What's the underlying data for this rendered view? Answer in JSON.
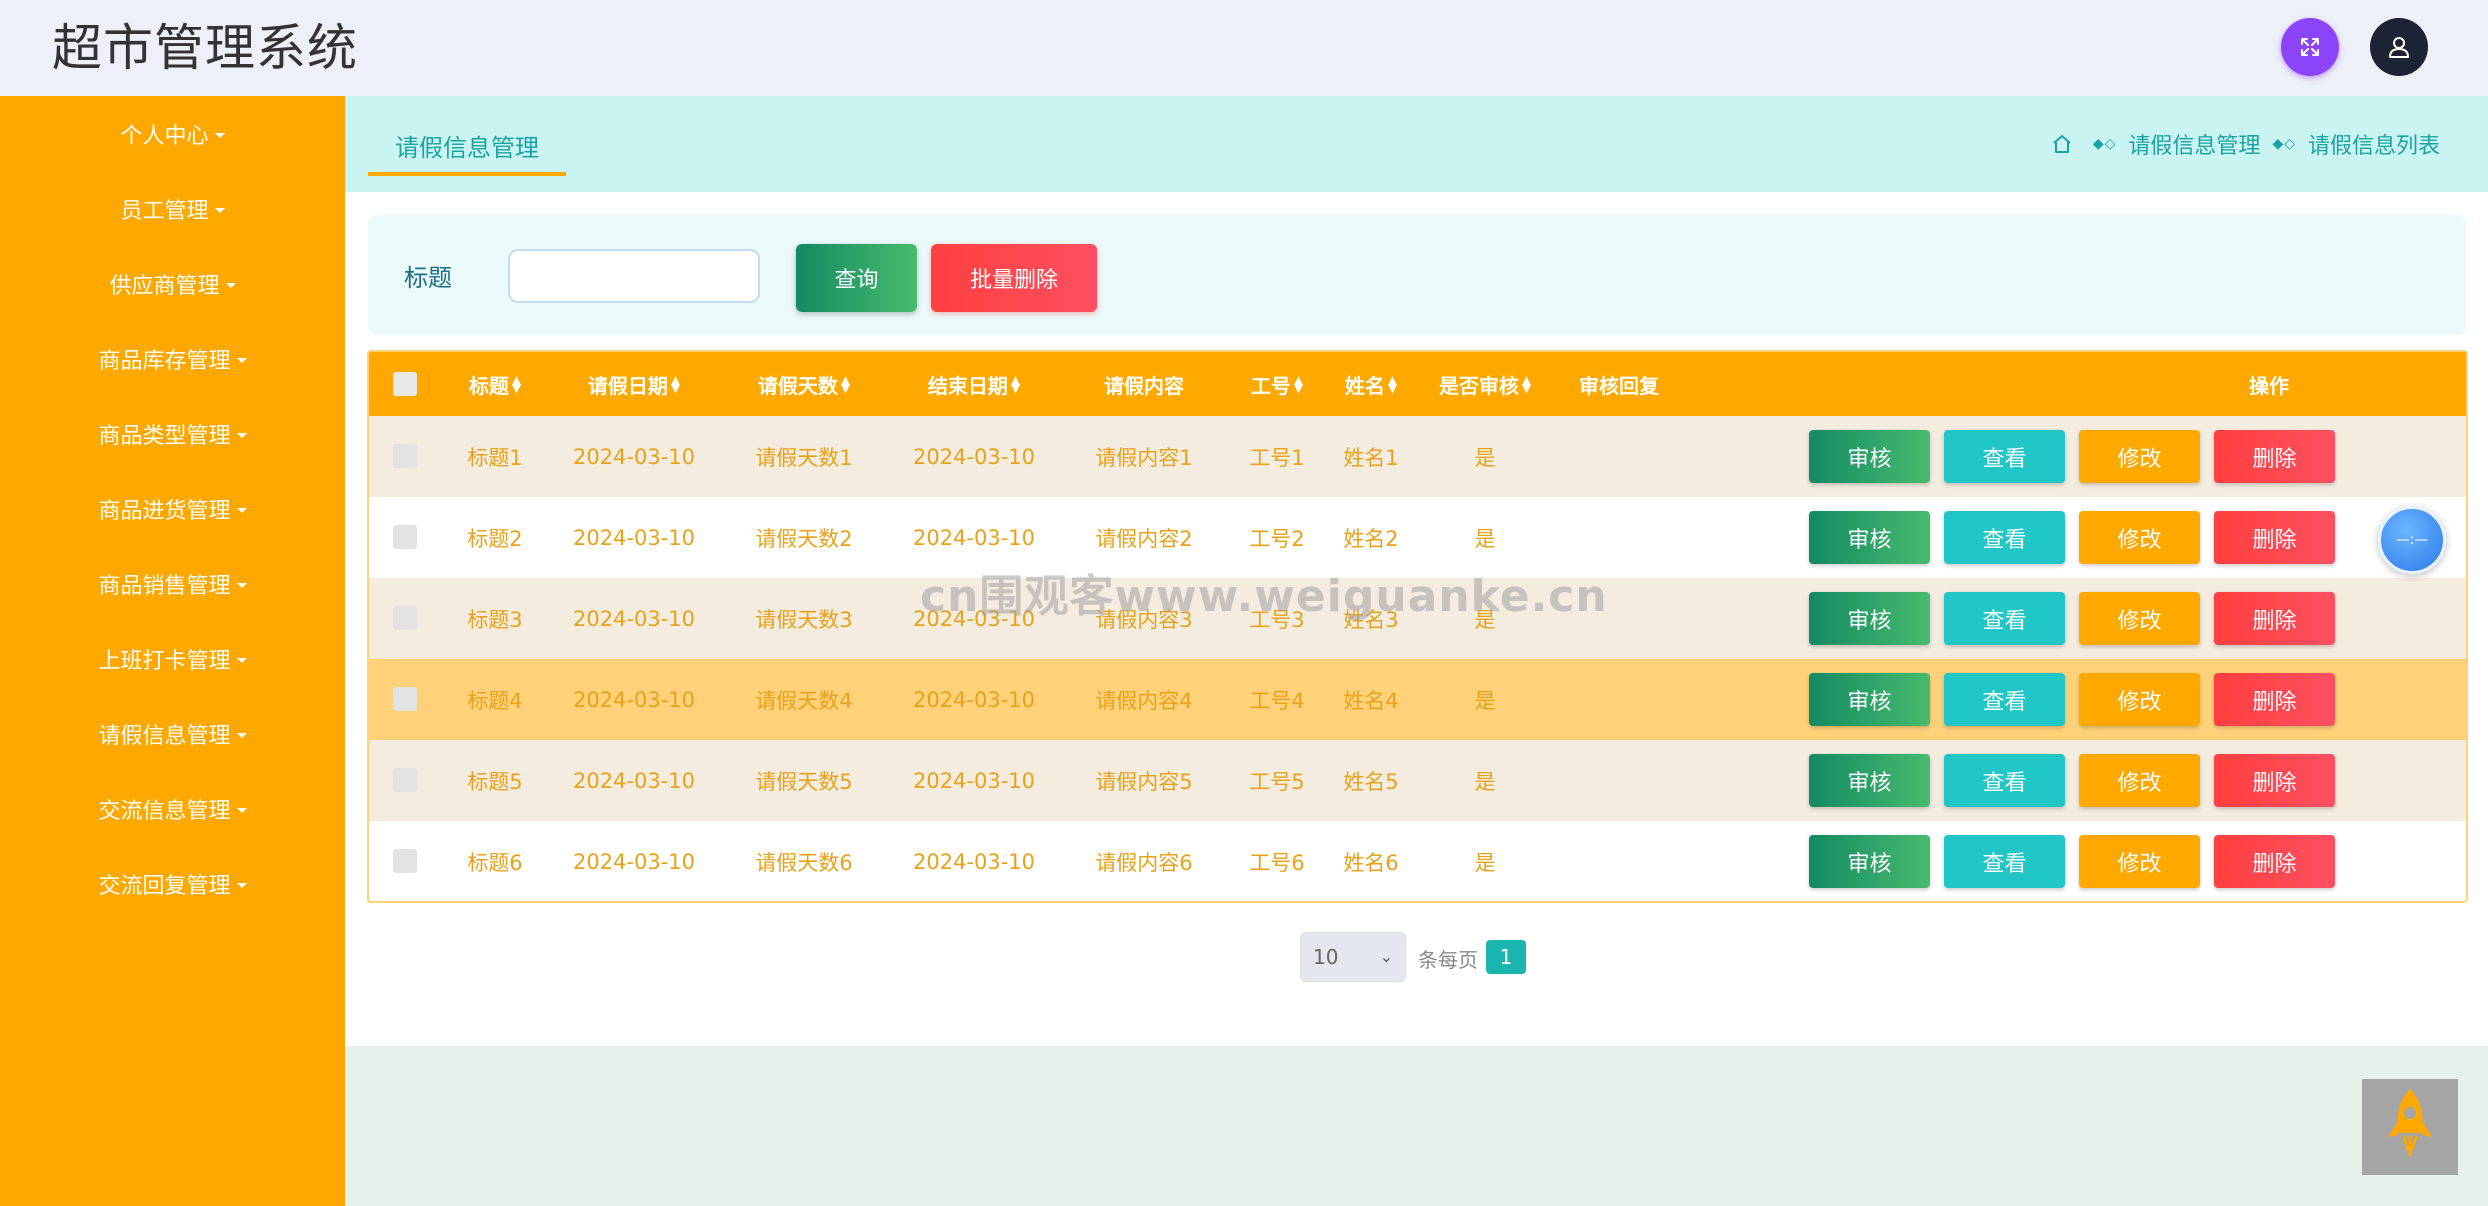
{
  "header": {
    "app_title": "超市管理系统",
    "accent_expand": "#8b44f7",
    "accent_user": "#1d2333"
  },
  "sidebar": {
    "color": "#ffa800",
    "items": [
      {
        "label": "个人中心"
      },
      {
        "label": "员工管理"
      },
      {
        "label": "供应商管理"
      },
      {
        "label": "商品库存管理"
      },
      {
        "label": "商品类型管理"
      },
      {
        "label": "商品进货管理"
      },
      {
        "label": "商品销售管理"
      },
      {
        "label": "上班打卡管理"
      },
      {
        "label": "请假信息管理"
      },
      {
        "label": "交流信息管理"
      },
      {
        "label": "交流回复管理"
      }
    ]
  },
  "page": {
    "tab_title": "请假信息管理",
    "breadcrumb": [
      "请假信息管理",
      "请假信息列表"
    ]
  },
  "search": {
    "label": "标题",
    "value": "",
    "query_button": "查询",
    "batch_delete_button": "批量删除"
  },
  "table": {
    "columns": [
      "标题",
      "请假日期",
      "请假天数",
      "结束日期",
      "请假内容",
      "工号",
      "姓名",
      "是否审核",
      "审核回复",
      "操作"
    ],
    "rows": [
      {
        "title": "标题1",
        "start": "2024-03-10",
        "days": "请假天数1",
        "end": "2024-03-10",
        "content": "请假内容1",
        "job_no": "工号1",
        "name": "姓名1",
        "audited": "是",
        "reply": ""
      },
      {
        "title": "标题2",
        "start": "2024-03-10",
        "days": "请假天数2",
        "end": "2024-03-10",
        "content": "请假内容2",
        "job_no": "工号2",
        "name": "姓名2",
        "audited": "是",
        "reply": ""
      },
      {
        "title": "标题3",
        "start": "2024-03-10",
        "days": "请假天数3",
        "end": "2024-03-10",
        "content": "请假内容3",
        "job_no": "工号3",
        "name": "姓名3",
        "audited": "是",
        "reply": ""
      },
      {
        "title": "标题4",
        "start": "2024-03-10",
        "days": "请假天数4",
        "end": "2024-03-10",
        "content": "请假内容4",
        "job_no": "工号4",
        "name": "姓名4",
        "audited": "是",
        "reply": ""
      },
      {
        "title": "标题5",
        "start": "2024-03-10",
        "days": "请假天数5",
        "end": "2024-03-10",
        "content": "请假内容5",
        "job_no": "工号5",
        "name": "姓名5",
        "audited": "是",
        "reply": ""
      },
      {
        "title": "标题6",
        "start": "2024-03-10",
        "days": "请假天数6",
        "end": "2024-03-10",
        "content": "请假内容6",
        "job_no": "工号6",
        "name": "姓名6",
        "audited": "是",
        "reply": ""
      }
    ],
    "actions": {
      "audit": "审核",
      "view": "查看",
      "edit": "修改",
      "delete": "删除"
    },
    "row_colors": [
      "#f5ece0",
      "#ffffff",
      "#f5ece0",
      "#ffd27a",
      "#f5ece0",
      "#ffffff"
    ]
  },
  "pagination": {
    "page_size": "10",
    "per_page_label": "条每页",
    "current_page": "1"
  },
  "watermark": "cn围观客www.weiguanke.cn",
  "floating": {
    "circle_text": "—:—"
  }
}
